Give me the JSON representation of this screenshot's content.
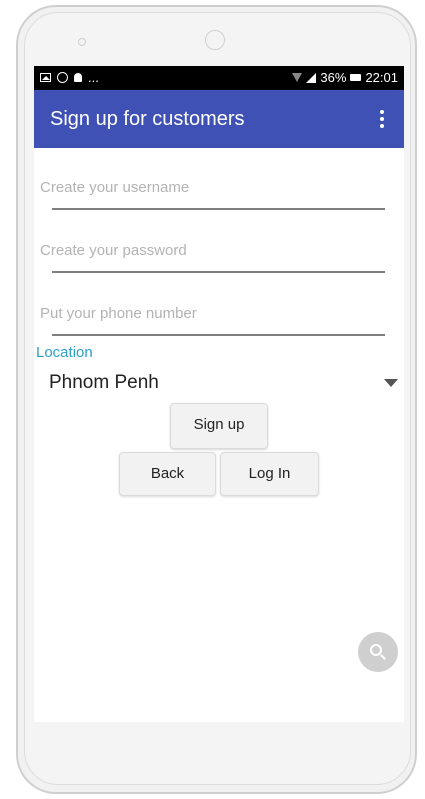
{
  "status_bar": {
    "left_icons": [
      "gallery-icon",
      "circle-icon",
      "bell-icon"
    ],
    "left_more": "...",
    "battery": "36%",
    "time": "22:01"
  },
  "app_bar": {
    "title": "Sign up for customers",
    "menu_icon": "overflow-menu-icon",
    "color": "#3f51b5"
  },
  "form": {
    "username_placeholder": "Create your username",
    "password_placeholder": "Create your password",
    "phone_placeholder": "Put your phone number",
    "location_label": "Location",
    "location_value": "Phnom Penh"
  },
  "buttons": {
    "signup": "Sign up",
    "back": "Back",
    "login": "Log In"
  },
  "fab": {
    "icon": "search-icon"
  },
  "colors": {
    "accent": "#2aa0c8",
    "appbar": "#3f51b5"
  }
}
